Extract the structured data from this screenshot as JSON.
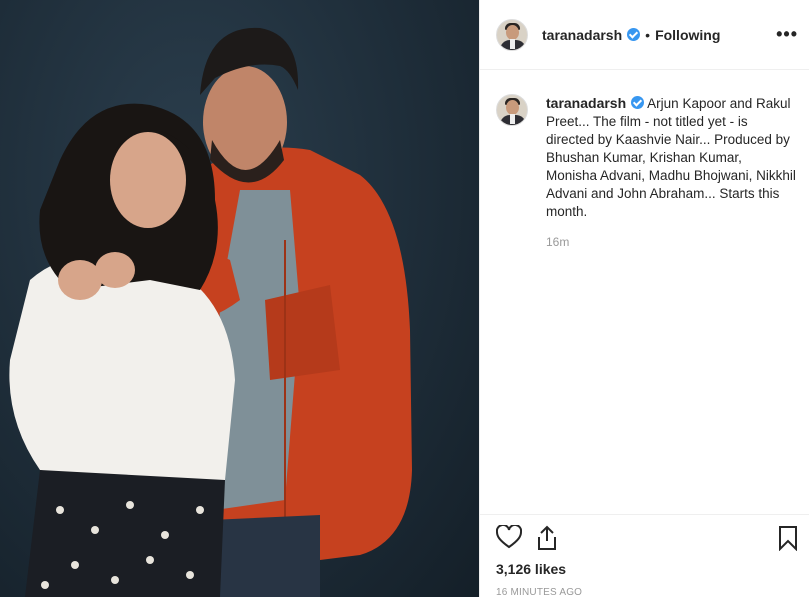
{
  "post": {
    "username": "taranadarsh",
    "follow_status": "Following",
    "separator": "•",
    "more_label": "•••",
    "caption": "Arjun Kapoor and Rakul Preet... The film - not titled yet - is directed by Kaashvie Nair... Produced by Bhushan Kumar, Krishan Kumar, Monisha Advani, Madhu Bhojwani, Nikkhil Advani and John Abraham... Starts this month.",
    "comment_time": "16m",
    "likes": "3,126 likes",
    "posted_ago": "16 MINUTES AGO"
  },
  "icons": {
    "header_avatar": "avatar-icon",
    "verified": "verified-badge-icon",
    "more": "more-options-icon",
    "like": "heart-icon",
    "share": "share-icon",
    "save": "bookmark-icon"
  },
  "colors": {
    "verified": "#3897f0",
    "photo_bg": "#1e2d39",
    "jacket": "#c6411f",
    "sweater": "#f2f0ec"
  }
}
